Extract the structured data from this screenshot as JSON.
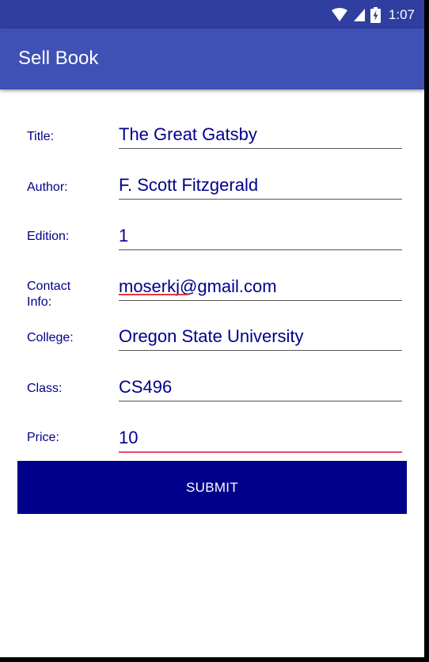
{
  "status_bar": {
    "time": "1:07",
    "icons": [
      "wifi-icon",
      "signal-icon",
      "battery-charging-icon"
    ]
  },
  "app_bar": {
    "title": "Sell Book"
  },
  "form": {
    "fields": [
      {
        "label": "Title:",
        "value": "The Great Gatsby"
      },
      {
        "label": "Author:",
        "value": "F. Scott Fitzgerald"
      },
      {
        "label": "Edition:",
        "value": "1"
      },
      {
        "label": "Contact Info:",
        "value": "moserkj@gmail.com"
      },
      {
        "label": "College:",
        "value": "Oregon State University"
      },
      {
        "label": "Class:",
        "value": "CS496"
      },
      {
        "label": "Price:",
        "value": "10"
      }
    ],
    "submit_label": "SUBMIT"
  },
  "colors": {
    "primary": "#3f51b5",
    "primary_dark": "#303f9f",
    "accent": "#e8467c",
    "text": "#00008b",
    "button": "#00008b"
  }
}
